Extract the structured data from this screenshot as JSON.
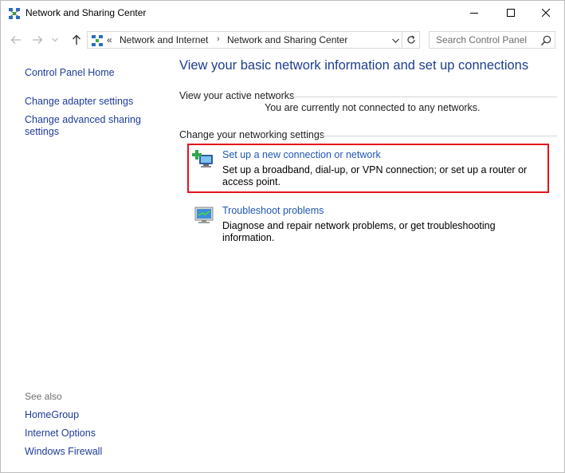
{
  "window": {
    "title": "Network and Sharing Center"
  },
  "address": {
    "chevron": "«",
    "crumbs": [
      "Network and Internet",
      "Network and Sharing Center"
    ],
    "separator": "›"
  },
  "search": {
    "placeholder": "Search Control Panel"
  },
  "sidebar": {
    "home": "Control Panel Home",
    "items": [
      {
        "label": "Change adapter settings"
      },
      {
        "label": "Change advanced sharing settings"
      }
    ],
    "see_also_label": "See also",
    "see_also": [
      {
        "label": "HomeGroup"
      },
      {
        "label": "Internet Options"
      },
      {
        "label": "Windows Firewall"
      }
    ]
  },
  "main": {
    "title": "View your basic network information and set up connections",
    "active_networks": {
      "heading": "View your active networks",
      "status": "You are currently not connected to any networks."
    },
    "settings": {
      "heading": "Change your networking settings",
      "tasks": [
        {
          "icon": "new-connection-icon",
          "link": "Set up a new connection or network",
          "description": "Set up a broadband, dial-up, or VPN connection; or set up a router or access point."
        },
        {
          "icon": "troubleshoot-icon",
          "link": "Troubleshoot problems",
          "description": "Diagnose and repair network problems, or get troubleshooting information."
        }
      ]
    }
  },
  "colors": {
    "link": "#1f57b5",
    "title": "#1e3d8e",
    "highlight_border": "#e3141e"
  }
}
